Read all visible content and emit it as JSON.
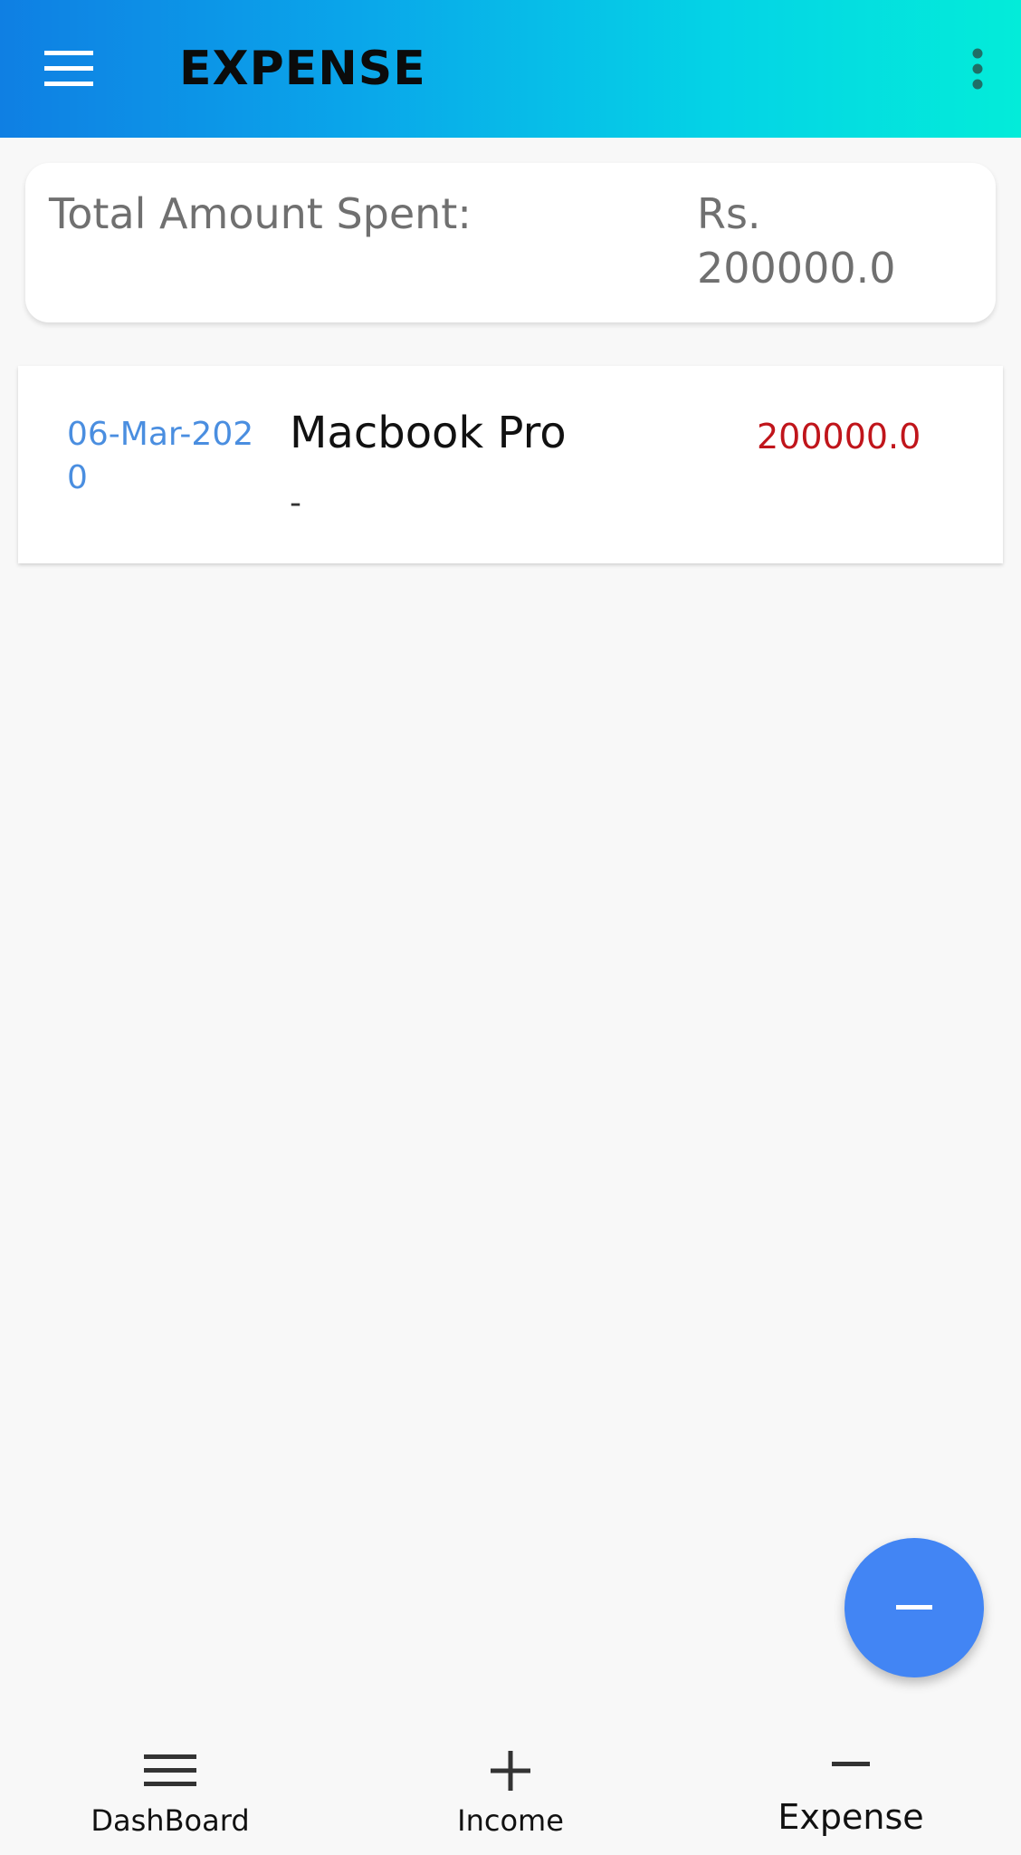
{
  "appbar": {
    "title": "EXPENSE",
    "menu_icon": "hamburger-menu-icon",
    "overflow_icon": "more-vert-icon"
  },
  "summary": {
    "label": "Total Amount Spent:",
    "amount": "Rs.\n200000.0"
  },
  "expenses": [
    {
      "date": "06-Mar-2020",
      "title": "Macbook Pro",
      "description": "-",
      "amount": "200000.0"
    }
  ],
  "fab": {
    "icon": "minus-icon"
  },
  "bottom_nav": {
    "items": [
      {
        "label": "DashBoard",
        "icon": "dashboard-icon"
      },
      {
        "label": "Income",
        "icon": "plus-icon"
      },
      {
        "label": "Expense",
        "icon": "minus-icon",
        "active": true
      }
    ]
  },
  "colors": {
    "appbar_gradient_start": "#0f7fe3",
    "appbar_gradient_end": "#03ecd9",
    "date_color": "#4a8ee0",
    "amount_color": "#c0151b",
    "fab_color": "#4285f4"
  }
}
